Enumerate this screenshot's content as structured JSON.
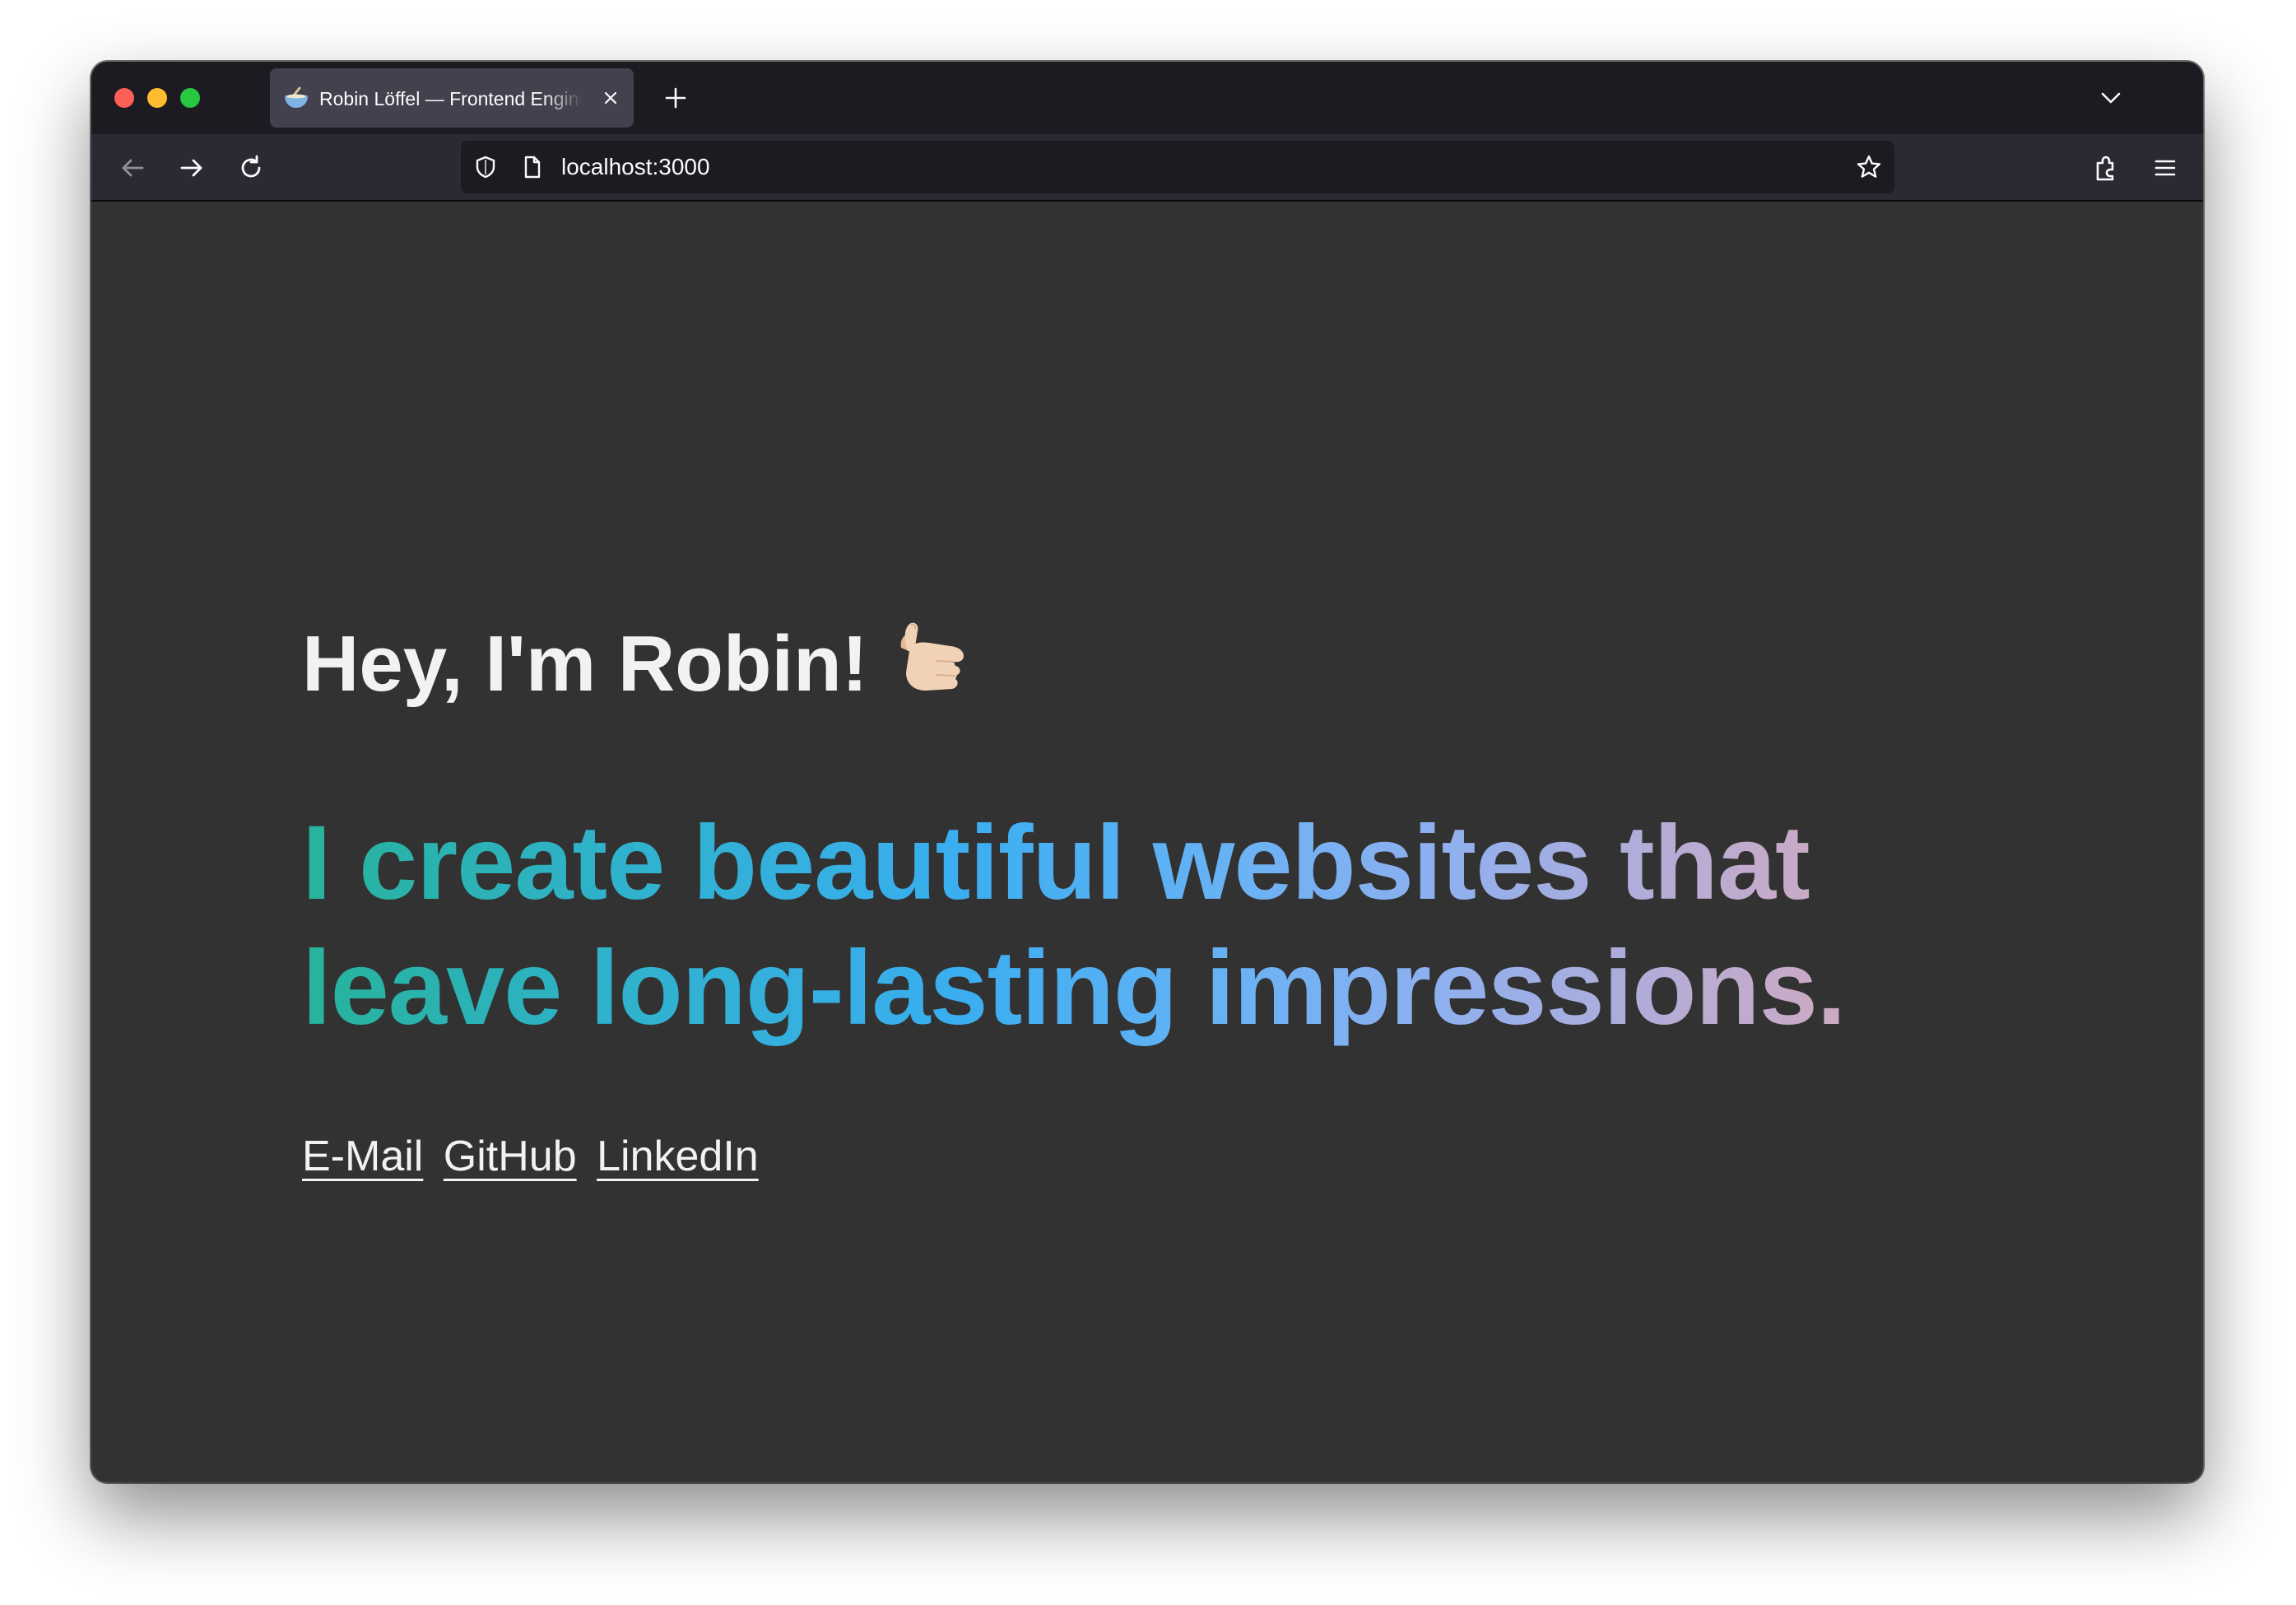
{
  "browser": {
    "tab": {
      "title": "Robin Löffel — Frontend Engineer",
      "favicon": "bowl-emoji-icon"
    },
    "url": "localhost:3000",
    "icons": [
      "back-arrow-icon",
      "forward-arrow-icon",
      "reload-icon",
      "shield-icon",
      "page-icon",
      "star-icon",
      "extensions-icon",
      "menu-icon",
      "new-tab-plus-icon",
      "tab-list-chevron-icon",
      "close-icon"
    ],
    "colors": {
      "tabstrip": "#1c1b22",
      "toolbar": "#2b2a33",
      "active_tab": "#42414d",
      "page_background": "#323232"
    }
  },
  "page": {
    "greeting": "Hey, I'm Robin!",
    "greeting_emoji": "call-me-hand-icon",
    "tagline": "I create beautiful websites that leave long-lasting impressions.",
    "tagline_gradient": [
      "#27b39a",
      "#3aaef0",
      "#8fb0ef",
      "#e3a8b2"
    ],
    "links": [
      {
        "label": "E-Mail"
      },
      {
        "label": "GitHub"
      },
      {
        "label": "LinkedIn"
      }
    ]
  }
}
